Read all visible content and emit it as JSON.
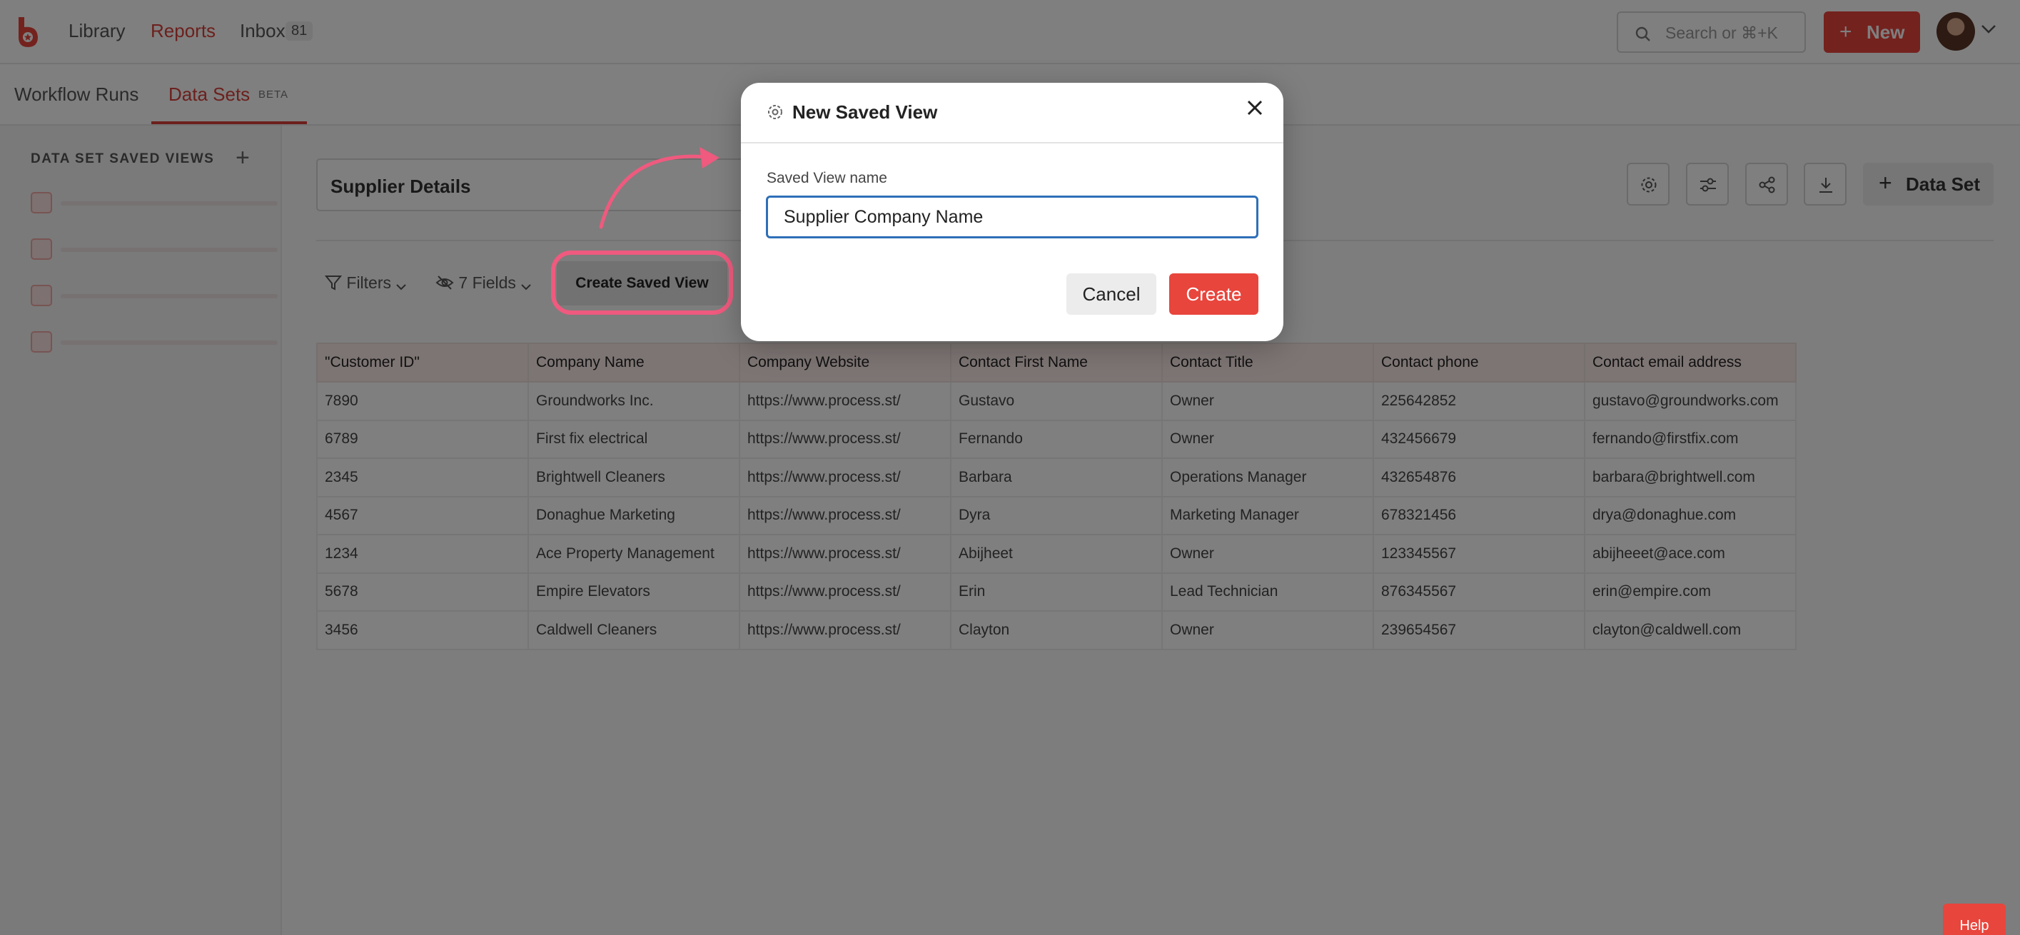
{
  "topnav": {
    "library": "Library",
    "reports": "Reports",
    "inbox": "Inbox",
    "inbox_count": "81",
    "search_placeholder": "Search or ⌘+K",
    "new_label": "New"
  },
  "subnav": {
    "workflow_runs": "Workflow Runs",
    "data_sets": "Data Sets",
    "beta": "BETA"
  },
  "sidebar": {
    "title": "DATA SET SAVED VIEWS"
  },
  "main": {
    "dataset_name": "Supplier Details",
    "dataset_button": "Data Set",
    "filters": "Filters",
    "fields": "7 Fields",
    "create_saved_view": "Create Saved View",
    "columns": [
      "\"Customer ID\"",
      "Company Name",
      "Company Website",
      "Contact First Name",
      "Contact Title",
      "Contact phone",
      "Contact email address"
    ],
    "rows": [
      [
        "7890",
        "Groundworks Inc.",
        "https://www.process.st/",
        "Gustavo",
        "Owner",
        "225642852",
        "gustavo@groundworks.com"
      ],
      [
        "6789",
        "First fix electrical",
        "https://www.process.st/",
        "Fernando",
        "Owner",
        "432456679",
        "fernando@firstfix.com"
      ],
      [
        "2345",
        "Brightwell Cleaners",
        "https://www.process.st/",
        "Barbara",
        "Operations Manager",
        "432654876",
        "barbara@brightwell.com"
      ],
      [
        "4567",
        "Donaghue Marketing",
        "https://www.process.st/",
        "Dyra",
        "Marketing Manager",
        "678321456",
        "drya@donaghue.com"
      ],
      [
        "1234",
        "Ace Property Management",
        "https://www.process.st/",
        "Abijheet",
        "Owner",
        "123345567",
        "abijheeet@ace.com"
      ],
      [
        "5678",
        "Empire Elevators",
        "https://www.process.st/",
        "Erin",
        "Lead Technician",
        "876345567",
        "erin@empire.com"
      ],
      [
        "3456",
        "Caldwell Cleaners",
        "https://www.process.st/",
        "Clayton",
        "Owner",
        "239654567",
        "clayton@caldwell.com"
      ]
    ]
  },
  "modal": {
    "title": "New Saved View",
    "field_label": "Saved View name",
    "field_value": "Supplier Company Name",
    "cancel": "Cancel",
    "create": "Create"
  },
  "help": "Help",
  "colors": {
    "brand": "#e8453c",
    "active_link": "#d9413a",
    "focus_border": "#2e6fb8",
    "highlight": "#ef5a7e"
  }
}
